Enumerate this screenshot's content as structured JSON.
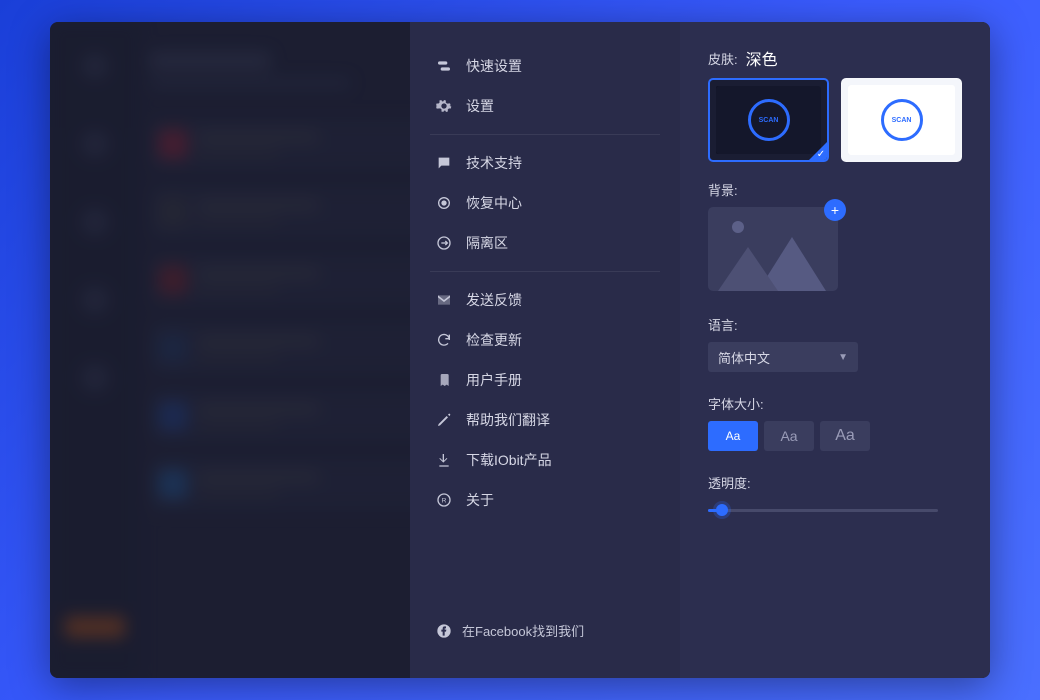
{
  "menu": {
    "items": [
      {
        "label": "快速设置"
      },
      {
        "label": "设置"
      },
      {
        "label": "技术支持"
      },
      {
        "label": "恢复中心"
      },
      {
        "label": "隔离区"
      },
      {
        "label": "发送反馈"
      },
      {
        "label": "检查更新"
      },
      {
        "label": "用户手册"
      },
      {
        "label": "帮助我们翻译"
      },
      {
        "label": "下载IObit产品"
      },
      {
        "label": "关于"
      }
    ],
    "facebook": "在Facebook找到我们"
  },
  "settings": {
    "skin_label": "皮肤:",
    "skin_value": "深色",
    "scan_text": "SCAN",
    "background_label": "背景:",
    "language_label": "语言:",
    "language_value": "简体中文",
    "font_label": "字体大小:",
    "font_sample": "Aa",
    "opacity_label": "透明度:"
  }
}
